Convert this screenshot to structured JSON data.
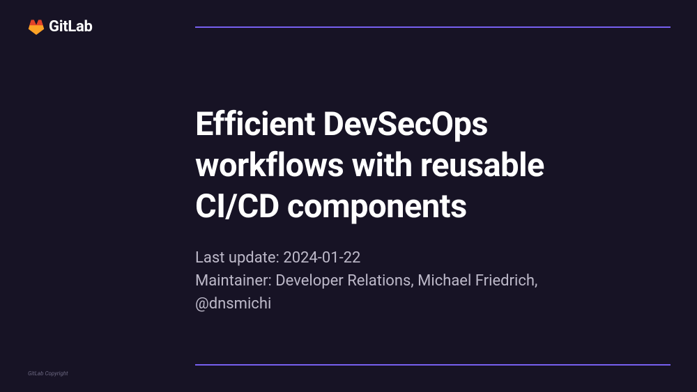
{
  "brand": {
    "name": "GitLab"
  },
  "slide": {
    "title": "Efficient DevSecOps\nworkflows with reusable\nCI/CD components",
    "last_update": "Last update: 2024-01-22",
    "maintainer": "Maintainer: Developer Relations, Michael Friedrich,\n@dnsmichi"
  },
  "footer": {
    "copyright": "GitLab Copyright"
  },
  "colors": {
    "background": "#171325",
    "accent": "#7760f0",
    "text_primary": "#ffffff",
    "text_secondary": "#bdb9c9"
  }
}
